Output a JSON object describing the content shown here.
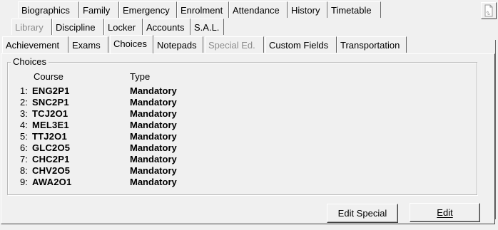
{
  "tabs": {
    "row1": [
      "Biographics",
      "Family",
      "Emergency",
      "Enrolment",
      "Attendance",
      "History",
      "Timetable"
    ],
    "row2": [
      {
        "label": "Library",
        "disabled": true
      },
      {
        "label": "Discipline",
        "disabled": false
      },
      {
        "label": "Locker",
        "disabled": false
      },
      {
        "label": "Accounts",
        "disabled": false
      },
      {
        "label": "S.A.L.",
        "disabled": false
      }
    ],
    "row3": [
      {
        "label": "Achievement",
        "disabled": false
      },
      {
        "label": "Exams",
        "disabled": false
      },
      {
        "label": "Choices",
        "disabled": false,
        "active": true
      },
      {
        "label": "Notepads",
        "disabled": false
      },
      {
        "label": "Special Ed.",
        "disabled": true
      },
      {
        "label": "Custom Fields",
        "disabled": false
      },
      {
        "label": "Transportation",
        "disabled": false
      }
    ]
  },
  "choices": {
    "group_title": "Choices",
    "col_course": "Course",
    "col_type": "Type",
    "rows": [
      {
        "num": "1:",
        "course": "ENG2P1",
        "type": "Mandatory"
      },
      {
        "num": "2:",
        "course": "SNC2P1",
        "type": "Mandatory"
      },
      {
        "num": "3:",
        "course": "TCJ2O1",
        "type": "Mandatory"
      },
      {
        "num": "4:",
        "course": "MEL3E1",
        "type": "Mandatory"
      },
      {
        "num": "5:",
        "course": "TTJ2O1",
        "type": "Mandatory"
      },
      {
        "num": "6:",
        "course": "GLC2O5",
        "type": "Mandatory"
      },
      {
        "num": "7:",
        "course": "CHC2P1",
        "type": "Mandatory"
      },
      {
        "num": "8:",
        "course": "CHV2O5",
        "type": "Mandatory"
      },
      {
        "num": "9:",
        "course": "AWA2O1",
        "type": "Mandatory"
      }
    ]
  },
  "buttons": {
    "edit_special": "Edit Special",
    "edit": "Edit"
  },
  "icons": {
    "corner_button": "document-icon"
  }
}
